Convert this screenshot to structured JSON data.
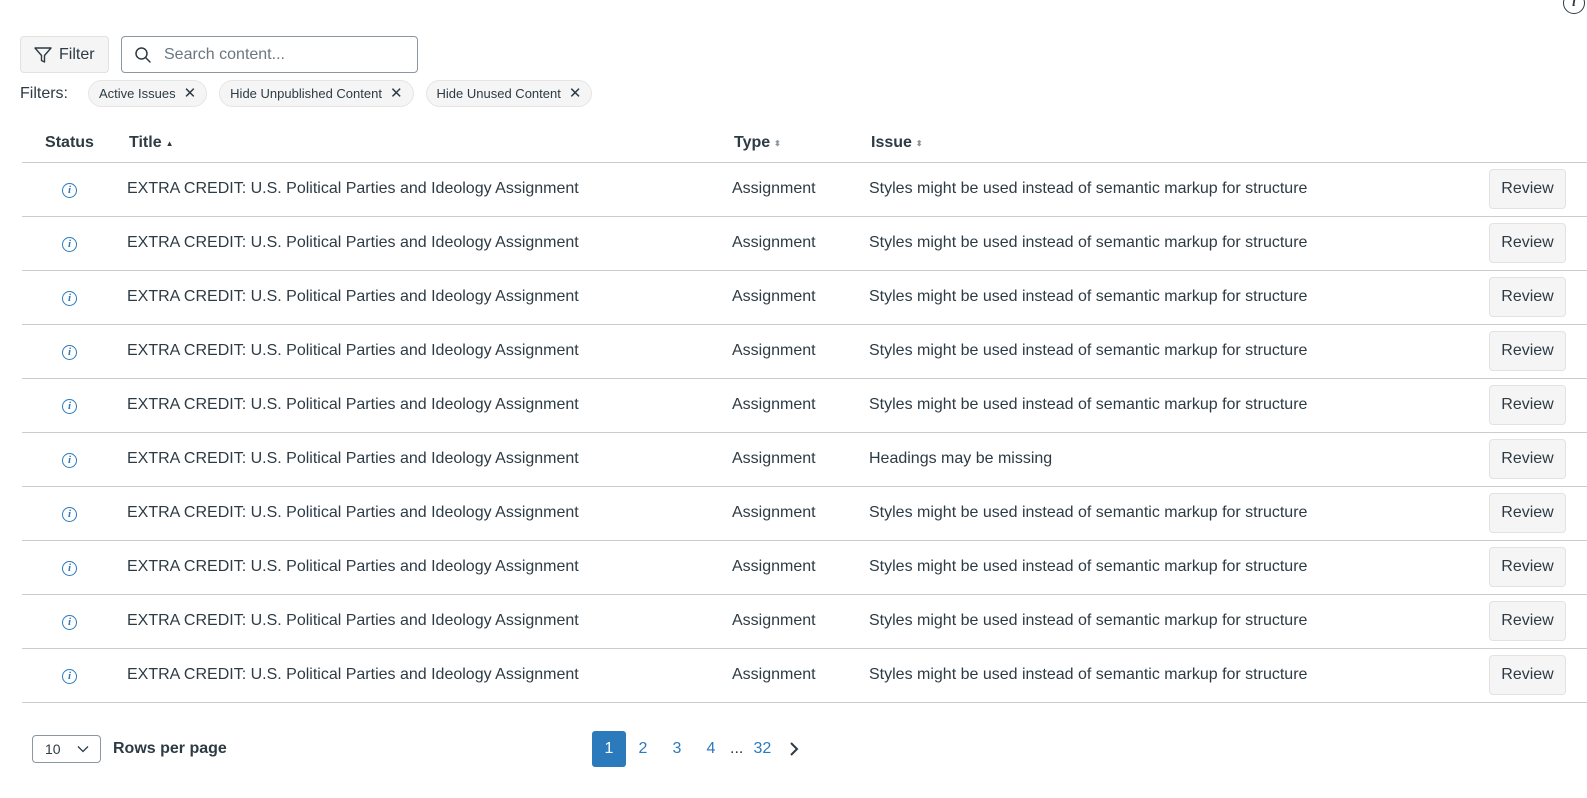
{
  "toolbar": {
    "filter_label": "Filter",
    "search_placeholder": "Search content..."
  },
  "filters": {
    "label": "Filters:",
    "chips": [
      "Active Issues",
      "Hide Unpublished Content",
      "Hide Unused Content"
    ]
  },
  "table": {
    "headers": {
      "status": "Status",
      "title": "Title",
      "type": "Type",
      "issue": "Issue"
    },
    "rows": [
      {
        "title": "EXTRA CREDIT: U.S. Political Parties and Ideology Assignment",
        "type": "Assignment",
        "issue": "Styles might be used instead of semantic markup for structure",
        "action": "Review"
      },
      {
        "title": "EXTRA CREDIT: U.S. Political Parties and Ideology Assignment",
        "type": "Assignment",
        "issue": "Styles might be used instead of semantic markup for structure",
        "action": "Review"
      },
      {
        "title": "EXTRA CREDIT: U.S. Political Parties and Ideology Assignment",
        "type": "Assignment",
        "issue": "Styles might be used instead of semantic markup for structure",
        "action": "Review"
      },
      {
        "title": "EXTRA CREDIT: U.S. Political Parties and Ideology Assignment",
        "type": "Assignment",
        "issue": "Styles might be used instead of semantic markup for structure",
        "action": "Review"
      },
      {
        "title": "EXTRA CREDIT: U.S. Political Parties and Ideology Assignment",
        "type": "Assignment",
        "issue": "Styles might be used instead of semantic markup for structure",
        "action": "Review"
      },
      {
        "title": "EXTRA CREDIT: U.S. Political Parties and Ideology Assignment",
        "type": "Assignment",
        "issue": "Headings may be missing",
        "action": "Review"
      },
      {
        "title": "EXTRA CREDIT: U.S. Political Parties and Ideology Assignment",
        "type": "Assignment",
        "issue": "Styles might be used instead of semantic markup for structure",
        "action": "Review"
      },
      {
        "title": "EXTRA CREDIT: U.S. Political Parties and Ideology Assignment",
        "type": "Assignment",
        "issue": "Styles might be used instead of semantic markup for structure",
        "action": "Review"
      },
      {
        "title": "EXTRA CREDIT: U.S. Political Parties and Ideology Assignment",
        "type": "Assignment",
        "issue": "Styles might be used instead of semantic markup for structure",
        "action": "Review"
      },
      {
        "title": "EXTRA CREDIT: U.S. Political Parties and Ideology Assignment",
        "type": "Assignment",
        "issue": "Styles might be used instead of semantic markup for structure",
        "action": "Review"
      }
    ]
  },
  "footer": {
    "rows_per_page_value": "10",
    "rows_per_page_label": "Rows per page",
    "pages": [
      "1",
      "2",
      "3",
      "4"
    ],
    "ellipsis": "...",
    "last_page": "32",
    "current_page": "1"
  },
  "colors": {
    "accent": "#2b7abc",
    "text": "#2d3b45",
    "border": "#c7cdd1"
  },
  "icons": {
    "status": "info-icon",
    "filter": "funnel-icon",
    "search": "search-icon",
    "chip_remove": "close-icon",
    "next": "chevron-right-icon",
    "select": "chevron-down-icon"
  }
}
